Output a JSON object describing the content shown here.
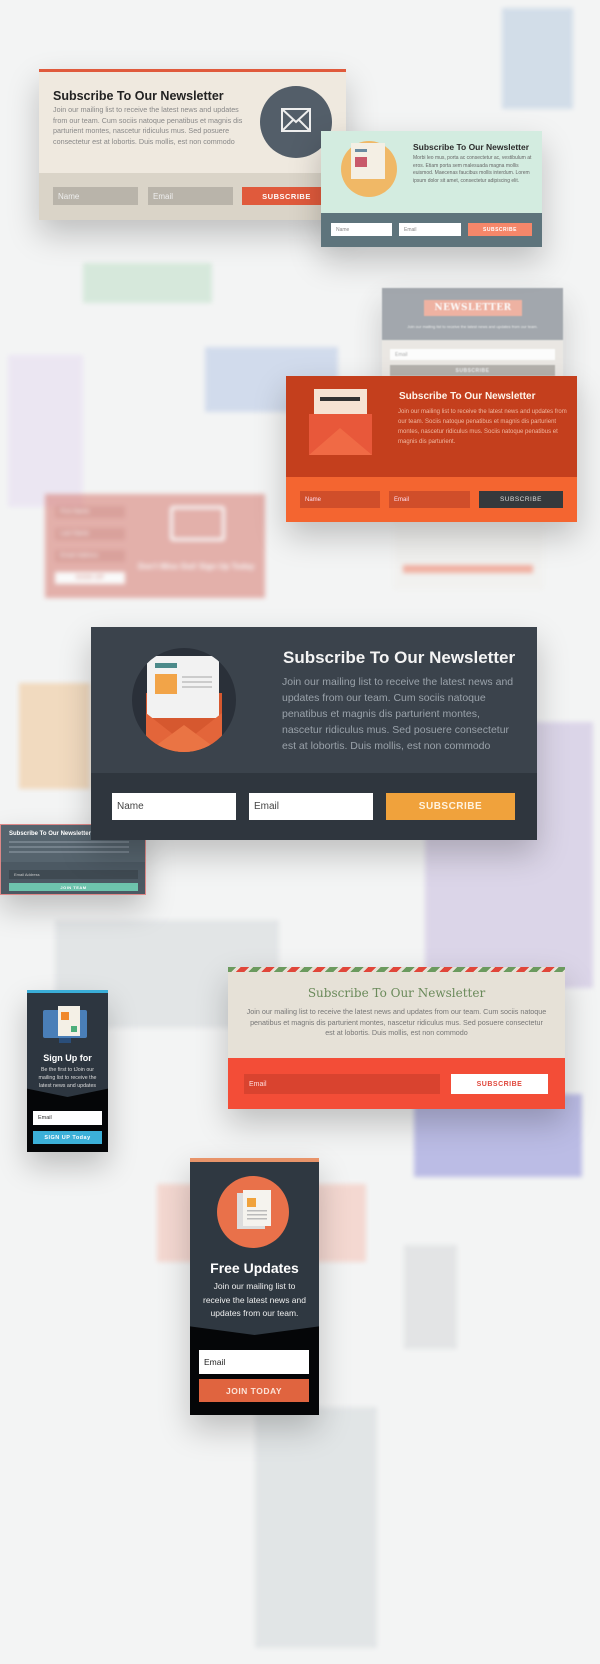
{
  "cards": {
    "beige": {
      "title": "Subscribe To Our Newsletter",
      "body": "Join our mailing list to receive the latest news and updates from our team. Cum sociis natoque penatibus et magnis dis parturient montes, nascetur ridiculus mus. Sed posuere consectetur est at lobortis. Duis mollis, est non commodo",
      "name_placeholder": "Name",
      "email_placeholder": "Email",
      "button": "SUBSCRIBE",
      "accent": "#e05a3c"
    },
    "mint": {
      "title": "Subscribe To Our Newsletter",
      "body": "Morbi leo mus, porta ac consectetur ac, vestibulum at eros. Etiam porta sem malesuada magna mollis euismod. Maecenas faucibus mollis interdum. Lorem ipsum dolor sit amet, consectetur adipiscing elit.",
      "name_placeholder": "Name",
      "email_placeholder": "Email",
      "button": "SUBSCRIBE"
    },
    "orange": {
      "title": "Subscribe To Our Newsletter",
      "body": "Join our mailing list to receive the latest news and updates from our team. Sociis natoque penatibus et magnis dis parturient montes, nascetur ridiculus mus. Sociis natoque penatibus et magnis dis parturient.",
      "name_placeholder": "Name",
      "email_placeholder": "Email",
      "button": "SUBSCRIBE"
    },
    "dark": {
      "title": "Subscribe To Our Newsletter",
      "body": "Join our mailing list to receive the latest news and updates from our team. Cum sociis natoque penatibus et magnis dis parturient montes, nascetur ridiculus mus. Sed posuere consectetur est at lobortis. Duis mollis, est non commodo",
      "name_placeholder": "Name",
      "email_placeholder": "Email",
      "button": "SUBSCRIBE",
      "accent": "#f0a23c"
    },
    "airmail": {
      "title": "Subscribe To Our Newsletter",
      "body": "Join our mailing list to receive the latest news and updates from our team. Cum sociis natoque penatibus et magnis dis parturient montes, nascetur ridiculus mus. Sed posuere consectetur est at lobortis. Duis mollis, est non commodo",
      "email_placeholder": "Email",
      "button": "SUBSCRIBE"
    },
    "free_updates": {
      "title": "Free Updates",
      "body": "Join our mailing list to receive the latest news and updates from our team.",
      "email_placeholder": "Email",
      "button": "JOIN TODAY"
    },
    "sign_up": {
      "title": "Sign Up for",
      "body": "Be the first to tJoin our mailing list to receive the latest news and updates",
      "email_placeholder": "Email",
      "button": "SIGN UP Today"
    },
    "small_dark": {
      "title": "Subscribe To Our Newsletter",
      "email_placeholder": "Email Address",
      "button": "JOIN TEAM"
    },
    "ribbon": {
      "title": "NEWSLETTER",
      "body": "Join our mailing list to receive the latest news and updates from our team.",
      "email_placeholder": "Email",
      "button": "SUBSCRIBE"
    },
    "dont_miss": {
      "title": "Don't Miss Out! Sign Up Today",
      "first_name": "First Name",
      "last_name": "Last Name",
      "email": "Email Address",
      "button": "SIGN UP"
    }
  }
}
